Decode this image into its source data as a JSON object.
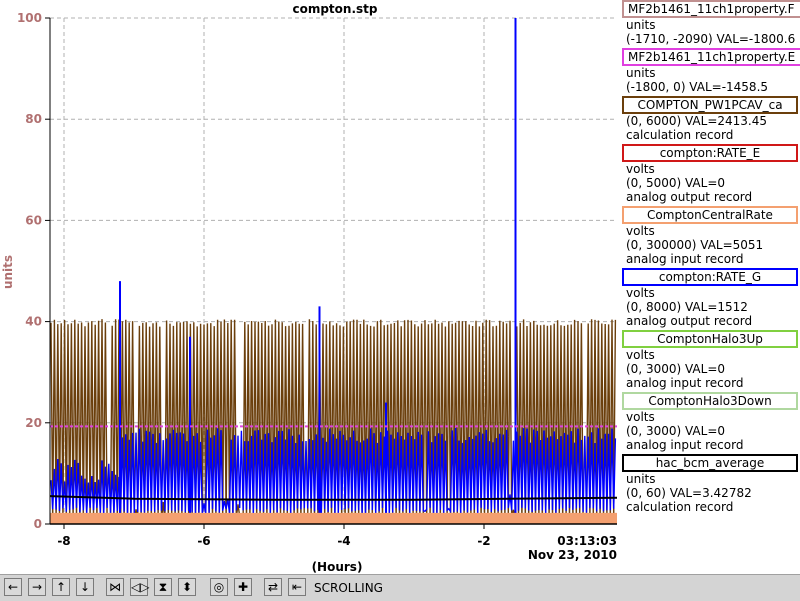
{
  "chart_data": {
    "type": "line",
    "title": "compton.stp",
    "xlabel": "(Hours)",
    "ylabel": "units",
    "xlim": [
      -8.2,
      -0.1
    ],
    "ylim": [
      0,
      100
    ],
    "x_ticks": [
      "-8",
      "-6",
      "-4",
      "-2"
    ],
    "x_tick_values": [
      -8,
      -6,
      -4,
      -2
    ],
    "y_ticks": [
      "0",
      "20",
      "40",
      "60",
      "80",
      "100"
    ],
    "y_tick_values": [
      0,
      20,
      40,
      60,
      80,
      100
    ],
    "timestamp_time": "03:13:03",
    "timestamp_date": "Nov 23, 2010",
    "grid": true,
    "legend_placement": "right",
    "series": [
      {
        "name": "COMPTON_PW1PCAV_ca",
        "color": "#6b3f0c",
        "style": "dense-oscillation",
        "low": 0.5,
        "high": 40.5
      },
      {
        "name": "compton:RATE_G",
        "color": "#0000ff",
        "style": "dense-oscillation",
        "low": 2,
        "high": 19,
        "spikes": [
          {
            "x": -7.2,
            "y": 48
          },
          {
            "x": -6.2,
            "y": 37
          },
          {
            "x": -4.35,
            "y": 43
          },
          {
            "x": -3.4,
            "y": 24
          },
          {
            "x": -1.55,
            "y": 100
          }
        ]
      },
      {
        "name": "ComptonCentralRate",
        "color": "#f4a070",
        "style": "band",
        "value": 1
      },
      {
        "name": "hac_bcm_average",
        "color": "#000000",
        "style": "line",
        "points": [
          [
            -8.2,
            5.5
          ],
          [
            -7,
            5
          ],
          [
            -5,
            4.8
          ],
          [
            -3,
            4.8
          ],
          [
            -0.1,
            5.2
          ]
        ]
      },
      {
        "name": "MF2b1461_11ch1property.E",
        "color": "#e040e0",
        "style": "line",
        "points": [
          [
            -8.2,
            19.3
          ],
          [
            -0.1,
            19.3
          ]
        ]
      }
    ]
  },
  "legend": [
    {
      "label": "MF2b1461_11ch1property.F",
      "color": "#c09090",
      "center": false,
      "lines": [
        "units",
        "(-1710, -2090) VAL=-1800.6"
      ]
    },
    {
      "label": "MF2b1461_11ch1property.E",
      "color": "#e040e0",
      "center": false,
      "lines": [
        "units",
        "(-1800, 0) VAL=-1458.5"
      ]
    },
    {
      "label": "COMPTON_PW1PCAV_ca",
      "color": "#6b3f0c",
      "center": true,
      "lines": [
        "(0, 6000) VAL=2413.45",
        "calculation record"
      ]
    },
    {
      "label": "compton:RATE_E",
      "color": "#d01818",
      "center": true,
      "lines": [
        "volts",
        "(0, 5000) VAL=0",
        "analog output record"
      ]
    },
    {
      "label": "ComptonCentralRate",
      "color": "#f4a070",
      "center": true,
      "lines": [
        "volts",
        "(0, 300000) VAL=5051",
        "analog input record"
      ]
    },
    {
      "label": "compton:RATE_G",
      "color": "#0000ff",
      "center": true,
      "lines": [
        "volts",
        "(0, 8000) VAL=1512",
        "analog output record"
      ]
    },
    {
      "label": "ComptonHalo3Up",
      "color": "#80d040",
      "center": true,
      "lines": [
        "volts",
        "(0, 3000) VAL=0",
        "analog input record"
      ]
    },
    {
      "label": "ComptonHalo3Down",
      "color": "#b0d8a0",
      "center": true,
      "lines": [
        "volts",
        "(0, 3000) VAL=0",
        "analog input record"
      ]
    },
    {
      "label": "hac_bcm_average",
      "color": "#000000",
      "center": true,
      "lines": [
        "units",
        "(0, 60) VAL=3.42782",
        "calculation record"
      ]
    }
  ],
  "toolbar": {
    "buttons": [
      {
        "name": "scroll-left-button",
        "glyph": "←"
      },
      {
        "name": "scroll-right-button",
        "glyph": "→"
      },
      {
        "name": "scroll-up-button",
        "glyph": "↑"
      },
      {
        "name": "scroll-down-button",
        "glyph": "↓"
      },
      {
        "name": "zoom-x-in-button",
        "glyph": "⋈"
      },
      {
        "name": "zoom-x-out-button",
        "glyph": "◁▷"
      },
      {
        "name": "zoom-y-in-button",
        "glyph": "⧗"
      },
      {
        "name": "zoom-y-out-button",
        "glyph": "⬍"
      },
      {
        "name": "auto-scale-button",
        "glyph": "◎"
      },
      {
        "name": "add-crosshair-button",
        "glyph": "✚"
      },
      {
        "name": "mode-toggle-button",
        "glyph": "⇄"
      },
      {
        "name": "scrolling-mode-button",
        "glyph": "⇤"
      }
    ],
    "mode_label": "SCROLLING"
  }
}
